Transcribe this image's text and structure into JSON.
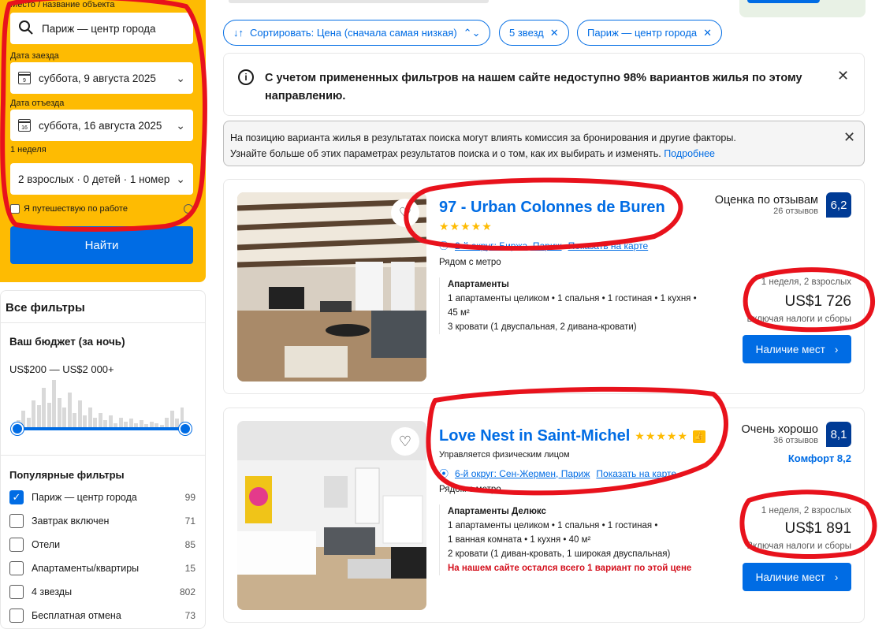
{
  "search": {
    "destination_label": "Место / название объекта",
    "destination_value": "Париж — центр города",
    "checkin_label": "Дата заезда",
    "checkin_day": "9",
    "checkin_value": "суббота, 9 августа 2025",
    "checkout_label": "Дата отъезда",
    "checkout_day": "16",
    "checkout_value": "суббота, 16 августа 2025",
    "duration": "1 неделя",
    "guests_value": "2 взрослых · 0 детей · 1 номер",
    "work_trip_label": "Я путешествую по работе",
    "search_button": "Найти"
  },
  "filters": {
    "title": "Все фильтры",
    "budget_title": "Ваш бюджет (за ночь)",
    "budget_range": "US$200 — US$2 000+",
    "budget_histogram": [
      0.15,
      0.35,
      0.2,
      0.55,
      0.45,
      0.8,
      0.5,
      0.95,
      0.6,
      0.4,
      0.7,
      0.3,
      0.55,
      0.25,
      0.4,
      0.2,
      0.3,
      0.15,
      0.25,
      0.1,
      0.2,
      0.12,
      0.18,
      0.1,
      0.15,
      0.08,
      0.12,
      0.1,
      0.06,
      0.2,
      0.35,
      0.18,
      0.4
    ],
    "popular_title": "Популярные фильтры",
    "items": [
      {
        "label": "Париж — центр города",
        "count": "99",
        "checked": true
      },
      {
        "label": "Завтрак включен",
        "count": "71",
        "checked": false
      },
      {
        "label": "Отели",
        "count": "85",
        "checked": false
      },
      {
        "label": "Апартаменты/квартиры",
        "count": "15",
        "checked": false
      },
      {
        "label": "4 звезды",
        "count": "802",
        "checked": false
      },
      {
        "label": "Бесплатная отмена",
        "count": "73",
        "checked": false
      }
    ]
  },
  "chips": {
    "sort": "Сортировать: Цена (сначала самая низкая)",
    "stars": "5 звезд",
    "area": "Париж — центр города"
  },
  "notices": {
    "availability": "С учетом примененных фильтров на нашем сайте недоступно 98% вариантов жилья по этому направлению.",
    "ranking_line1": "На позицию варианта жилья в результатах поиска могут влиять комиссия за бронирования и другие факторы.",
    "ranking_line2": "Узнайте больше об этих параметрах результатов поиска и о том, как их выбирать и изменять.",
    "ranking_link": "Подробнее"
  },
  "listings": [
    {
      "title": "97 - Urban Colonnes de Buren",
      "stars": "★★★★★",
      "location": "2-й округ: Биржа, Париж",
      "map_link": "Показать на карте",
      "metro": "Рядом с метро",
      "review_label": "Оценка по отзывам",
      "review_count": "26 отзывов",
      "score": "6,2",
      "room_type": "Апартаменты",
      "room_details_1": "1 апартаменты целиком • 1 спальня • 1 гостиная • 1 кухня •",
      "room_details_2": "45 м²",
      "beds": "3 кровати (1 двуспальная, 2 дивана-кровати)",
      "stay": "1 неделя, 2 взрослых",
      "price": "US$1 726",
      "taxes": "Включая налоги и сборы",
      "button": "Наличие мест"
    },
    {
      "title": "Love Nest in Saint-Michel",
      "stars": "★★★★★",
      "managed_by": "Управляется физическим лицом",
      "location": "6-й округ: Сен-Жермен, Париж",
      "map_link": "Показать на карте",
      "metro": "Рядом с метро",
      "review_label": "Очень хорошо",
      "review_count": "36 отзывов",
      "score": "8,1",
      "comfort": "Комфорт 8,2",
      "room_type": "Апартаменты Делюкс",
      "room_details_1": "1 апартаменты целиком • 1 спальня • 1 гостиная •",
      "room_details_2": "1 ванная комната • 1 кухня • 40 м²",
      "beds": "2 кровати (1 диван-кровать, 1 широкая двуспальная)",
      "scarcity": "На нашем сайте остался всего 1 вариант по этой цене",
      "stay": "1 неделя, 2 взрослых",
      "price": "US$1 891",
      "taxes": "Включая налоги и сборы",
      "button": "Наличие мест"
    }
  ],
  "colors": {
    "accent": "#006ce4",
    "panel": "#febb02",
    "score": "#003b95",
    "annotation": "#e8121c"
  }
}
